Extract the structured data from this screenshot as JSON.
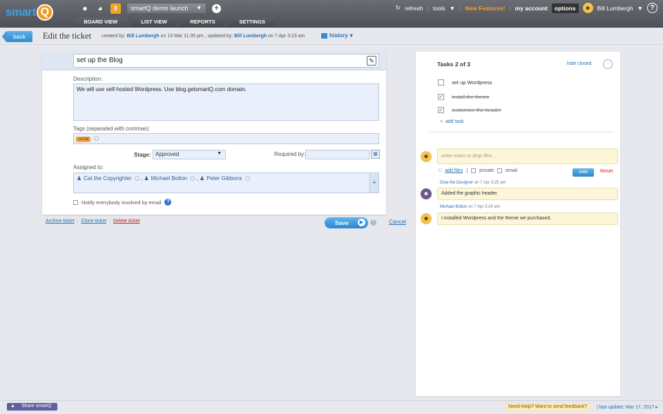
{
  "app": {
    "logo_text": "smart",
    "logo_q": "Q"
  },
  "header": {
    "project": "smartQ demo launch",
    "tabs": [
      "BOARD VIEW",
      "LIST VIEW",
      "REPORTS",
      "SETTINGS"
    ],
    "refresh": "refresh",
    "tools": "tools",
    "new_features": "New Features!",
    "my_account": "my account",
    "options": "options",
    "user": "Bill Lumbergh",
    "help": "?"
  },
  "subbar": {
    "back": "back",
    "title": "Edit the ticket",
    "created_prefix": "created by:",
    "created_by": "Bill Lumbergh",
    "created_on": "on 13 Mar 11:35 pm , updated by:",
    "updated_by": "Bill Lumbergh",
    "updated_on": "on 7 Apr 3:23 am",
    "history": "history"
  },
  "ticket": {
    "title": "set up the Blog",
    "description_label": "Description:",
    "description": "We will use self-hosted Wordpress. Use blog.getsmartQ.com domain.",
    "tags_label": "Tags (separated with commas):",
    "tag": "social",
    "stage_label": "Stage:",
    "stage_value": "Approved",
    "required_label": "Required by:",
    "assigned_label": "Assigned to:",
    "assignees": [
      "Cat the Copyrighter",
      "Michael Bolton",
      "Peter Gibbons"
    ],
    "notify_label": "Notify everybody involved by email"
  },
  "actions": {
    "archive": "Archive ticket",
    "clone": "Clone ticket",
    "delete": "Delete ticket",
    "save": "Save",
    "cancel": "Cancel"
  },
  "tasks": {
    "title": "Tasks 2 of 3",
    "hide_closed": "hide closed",
    "more": "···",
    "items": [
      {
        "label": "set up Wordpress",
        "done": false
      },
      {
        "label": "install the theme",
        "done": true
      },
      {
        "label": "customize the header",
        "done": true
      }
    ],
    "add": "add task"
  },
  "notes": {
    "placeholder": "enter notes or drop files...",
    "add_files": "add files",
    "private": "private",
    "email": "email",
    "add_button": "Add",
    "reset": "Reset",
    "comments": [
      {
        "author": "Dina the Designer",
        "when": "on 7 Apr 3:25 am",
        "text": "Added the graphic header."
      },
      {
        "author": "Michael Bolton",
        "when": "on 7 Apr 3:24 am",
        "text": "I installed Wordpress and the theme we purchased."
      }
    ]
  },
  "footer": {
    "share": "Share smartQ",
    "feedback": "Need Help? Want to send feedback?",
    "last_update": "| last update: Mar 17, 2017 ▸"
  },
  "colors": {
    "accent": "#2a87cf",
    "brand_orange": "#f39a1d",
    "delete_red": "#c0211d"
  }
}
